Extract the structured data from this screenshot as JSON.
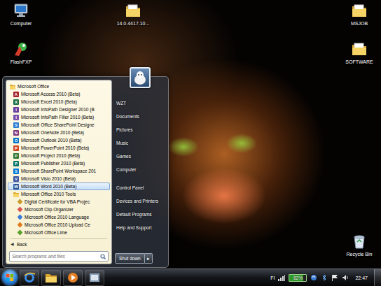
{
  "desktop": {
    "icons": [
      {
        "label": "Computer",
        "kind": "computer"
      },
      {
        "label": "FlashFXP",
        "kind": "ftp"
      },
      {
        "kind": "app"
      },
      {
        "label": "14.0.4417.10...",
        "kind": "folder"
      },
      {
        "label": "MSJOB",
        "kind": "folder"
      },
      {
        "label": "SOFTWARE",
        "kind": "folder"
      },
      {
        "label": "Recycle Bin",
        "kind": "recycle"
      }
    ]
  },
  "start_menu": {
    "programs": [
      {
        "label": "Microsoft Office",
        "kind": "root-folder",
        "selected": false
      },
      {
        "label": "Microsoft Access 2010 (Beta)",
        "kind": "app",
        "icon": "A",
        "color": "#a4262c",
        "selected": false
      },
      {
        "label": "Microsoft Excel 2010 (Beta)",
        "kind": "app",
        "icon": "X",
        "color": "#1e7145",
        "selected": false
      },
      {
        "label": "Microsoft InfoPath Designer 2010 (B",
        "kind": "app",
        "icon": "I",
        "color": "#6b3fa0",
        "selected": false
      },
      {
        "label": "Microsoft InfoPath Filler 2010 (Beta)",
        "kind": "app",
        "icon": "I",
        "color": "#7a4fb0",
        "selected": false
      },
      {
        "label": "Microsoft Office SharePoint Designe",
        "kind": "app",
        "icon": "S",
        "color": "#2b7cd3",
        "selected": false
      },
      {
        "label": "Microsoft OneNote 2010 (Beta)",
        "kind": "app",
        "icon": "N",
        "color": "#80397b",
        "selected": false
      },
      {
        "label": "Microsoft Outlook 2010 (Beta)",
        "kind": "app",
        "icon": "O",
        "color": "#0072c6",
        "selected": false
      },
      {
        "label": "Microsoft PowerPoint 2010 (Beta)",
        "kind": "app",
        "icon": "P",
        "color": "#d24726",
        "selected": false
      },
      {
        "label": "Microsoft Project 2010 (Beta)",
        "kind": "app",
        "icon": "P",
        "color": "#31752f",
        "selected": false
      },
      {
        "label": "Microsoft Publisher 2010 (Beta)",
        "kind": "app",
        "icon": "P",
        "color": "#077568",
        "selected": false
      },
      {
        "label": "Microsoft SharePoint Workspace 201",
        "kind": "app",
        "icon": "S",
        "color": "#0078d7",
        "selected": false
      },
      {
        "label": "Microsoft Visio 2010 (Beta)",
        "kind": "app",
        "icon": "V",
        "color": "#3955a3",
        "selected": false
      },
      {
        "label": "Microsoft Word 2010 (Beta)",
        "kind": "app",
        "icon": "W",
        "color": "#2b579a",
        "selected": true
      },
      {
        "label": "Microsoft Office 2010 Tools",
        "kind": "folder",
        "selected": false
      },
      {
        "label": "Digital Certificate for VBA Projec",
        "kind": "tool",
        "color": "#c79a2a",
        "selected": false
      },
      {
        "label": "Microsoft Clip Organizer",
        "kind": "tool",
        "color": "#d9534f",
        "selected": false
      },
      {
        "label": "Microsoft Office 2010 Language",
        "kind": "tool",
        "color": "#3a7bd5",
        "selected": false
      },
      {
        "label": "Microsoft Office 2010 Upload Ce",
        "kind": "tool",
        "color": "#e07b1f",
        "selected": false
      },
      {
        "label": "Microsoft Office Lime",
        "kind": "tool",
        "color": "#5aa02c",
        "selected": false
      }
    ],
    "back": {
      "icon": "◀",
      "label": "Back"
    },
    "search": {
      "placeholder": "Search programs and files"
    },
    "places": [
      {
        "items": [
          "WZT",
          "Documents",
          "Pictures",
          "Music",
          "Games",
          "Computer"
        ]
      },
      {
        "items": [
          "Control Panel",
          "Devices and Printers",
          "Default Programs",
          "Help and Support"
        ]
      }
    ],
    "shutdown": {
      "label": "Shut down",
      "arrow": "▸"
    }
  },
  "taskbar": {
    "pinned": [
      {
        "kind": "ie"
      },
      {
        "kind": "explorer"
      },
      {
        "kind": "media"
      },
      {
        "kind": "app"
      }
    ],
    "tray": {
      "language": "FI",
      "battery": {
        "reading": "82%",
        "level": 0.82
      },
      "clock": "22:47"
    }
  }
}
